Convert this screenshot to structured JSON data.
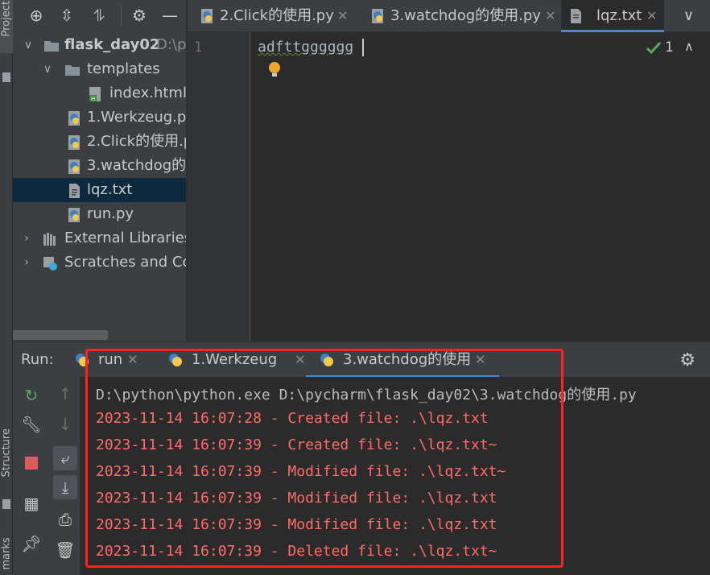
{
  "left_strip": {
    "project_label": "Project",
    "structure_label": "Structure",
    "bookmarks_label": "marks"
  },
  "project_panel": {
    "toolbar_icons": [
      "target-icon",
      "expand-all-icon",
      "collapse-all-icon",
      "gear-icon",
      "minimize-icon"
    ],
    "tree": {
      "root_name": "flask_day02",
      "root_path": "D:\\p",
      "templates_folder": "templates",
      "index_file": "index.html",
      "file_1": "1.Werkzeug.py",
      "file_2": "2.Click的使用.p",
      "file_3": "3.watchdog的使",
      "file_4": "lqz.txt",
      "file_5": "run.py",
      "external_libraries": "External Libraries",
      "scratches": "Scratches and Cor"
    }
  },
  "editor": {
    "tabs": [
      {
        "label": "2.Click的使用.py",
        "icon": "python-file-icon"
      },
      {
        "label": "3.watchdog的使用.py",
        "icon": "python-file-icon"
      },
      {
        "label": "lqz.txt",
        "icon": "text-file-icon"
      }
    ],
    "active_tab_index": 2,
    "line_number": "1",
    "code_line": "adfttgggggg",
    "inspection_count": "1"
  },
  "run_panel": {
    "label": "Run:",
    "tabs": [
      {
        "label": "run"
      },
      {
        "label": "1.Werkzeug"
      },
      {
        "label": "3.watchdog的使用"
      }
    ],
    "active_tab_index": 2,
    "console": {
      "command": "D:\\python\\python.exe D:\\pycharm\\flask_day02\\3.watchdog的使用.py",
      "log_lines": [
        "2023-11-14 16:07:28 - Created file: .\\lqz.txt",
        "2023-11-14 16:07:39 - Created file: .\\lqz.txt~",
        "2023-11-14 16:07:39 - Modified file: .\\lqz.txt~",
        "2023-11-14 16:07:39 - Modified file: .\\lqz.txt",
        "2023-11-14 16:07:39 - Modified file: .\\lqz.txt",
        "2023-11-14 16:07:39 - Deleted file: .\\lqz.txt~"
      ]
    }
  },
  "colors": {
    "background": "#2b2b2b",
    "panel": "#3c3f41",
    "selection": "#0d293e",
    "log_text": "#ff6b68",
    "highlight_border": "#ff2020",
    "accent": "#4a88c7"
  }
}
